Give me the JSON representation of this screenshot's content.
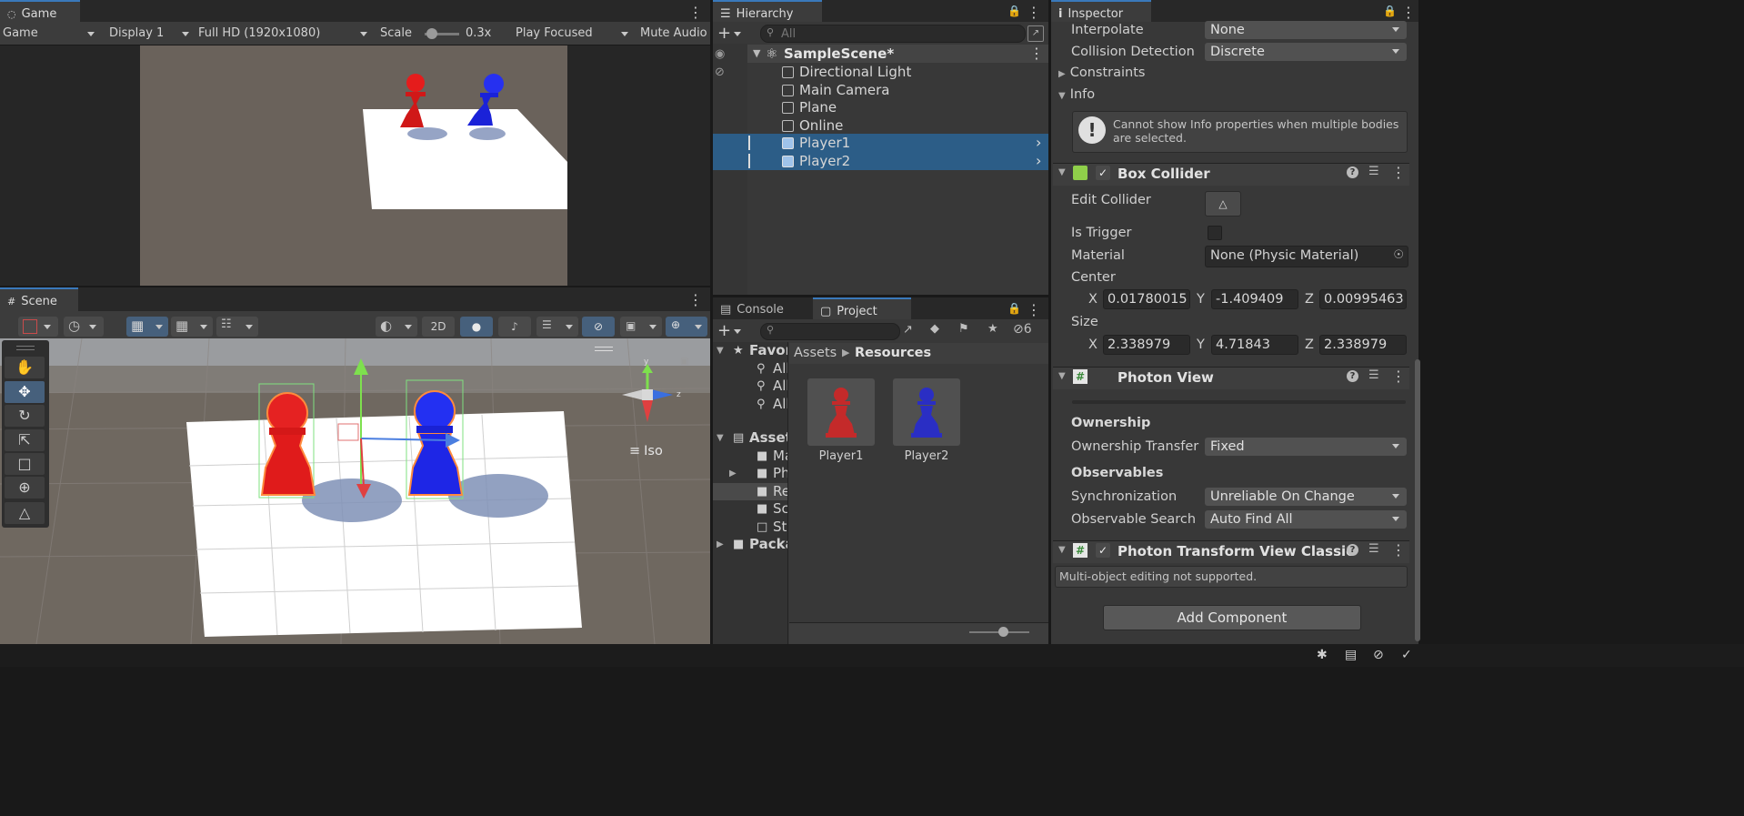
{
  "game": {
    "tab": "Game",
    "dropdowns": {
      "mode": "Game",
      "display": "Display 1",
      "resolution": "Full HD (1920x1080)",
      "play": "Play Focused",
      "mute": "Mute Audio"
    },
    "scale_label": "Scale",
    "scale_value": "0.3x"
  },
  "scene": {
    "tab": "Scene",
    "toggle_2d": "2D",
    "gizmo_label": "Iso",
    "gizmo_axes": {
      "y": "y",
      "z": "z"
    }
  },
  "hierarchy": {
    "tab": "Hierarchy",
    "search_placeholder": "All",
    "scene_name": "SampleScene*",
    "items": [
      {
        "label": "Directional Light",
        "selected": false
      },
      {
        "label": "Main Camera",
        "selected": false
      },
      {
        "label": "Plane",
        "selected": false
      },
      {
        "label": "Online",
        "selected": false
      },
      {
        "label": "Player1",
        "selected": true
      },
      {
        "label": "Player2",
        "selected": true
      }
    ]
  },
  "bottom_tabs": {
    "console": "Console",
    "project": "Project"
  },
  "project": {
    "hidden_count": "6",
    "tree": [
      {
        "label": "Favorites",
        "bold": true
      },
      {
        "label": "All",
        "bold": false
      },
      {
        "label": "All",
        "bold": false
      },
      {
        "label": "All",
        "bold": false
      },
      {
        "label": "Assets",
        "bold": true
      },
      {
        "label": "Materials",
        "bold": false
      },
      {
        "label": "Photon",
        "bold": false
      },
      {
        "label": "Resources",
        "bold": false
      },
      {
        "label": "Scenes",
        "bold": false
      },
      {
        "label": "StreamingAssets",
        "bold": false
      },
      {
        "label": "Packages",
        "bold": true
      }
    ],
    "breadcrumb": [
      "Assets",
      "Resources"
    ],
    "assets": [
      {
        "label": "Player1",
        "color": "#c42a2a"
      },
      {
        "label": "Player2",
        "color": "#2a2ec4"
      }
    ]
  },
  "inspector": {
    "tab": "Inspector",
    "rigidbody": {
      "interpolate_label": "Interpolate",
      "interpolate_value": "None",
      "collision_label": "Collision Detection",
      "collision_value": "Discrete",
      "constraints": "Constraints",
      "info": "Info",
      "info_message": "Cannot show Info properties when multiple bodies are selected."
    },
    "box_collider": {
      "title": "Box Collider",
      "edit_collider": "Edit Collider",
      "is_trigger": "Is Trigger",
      "material_label": "Material",
      "material_value": "None (Physic Material)",
      "center_label": "Center",
      "center": {
        "x": "0.01780015",
        "y": "-1.409409",
        "z": "0.00995463"
      },
      "size_label": "Size",
      "size": {
        "x": "2.338979",
        "y": "4.71843",
        "z": "2.338979"
      },
      "axis": {
        "x": "X",
        "y": "Y",
        "z": "Z"
      }
    },
    "photon_view": {
      "title": "Photon View",
      "ownership_header": "Ownership",
      "ownership_transfer_label": "Ownership Transfer",
      "ownership_transfer_value": "Fixed",
      "observables_header": "Observables",
      "sync_label": "Synchronization",
      "sync_value": "Unreliable On Change",
      "obs_search_label": "Observable Search",
      "obs_search_value": "Auto Find All"
    },
    "photon_transform": {
      "title": "Photon Transform View Classic",
      "message": "Multi-object editing not supported."
    },
    "add_component": "Add Component"
  },
  "colors": {
    "selection": "#2c5d87",
    "accent": "#3a79bb",
    "red_pawn": "#e11c1c",
    "blue_pawn": "#1f28e6"
  }
}
